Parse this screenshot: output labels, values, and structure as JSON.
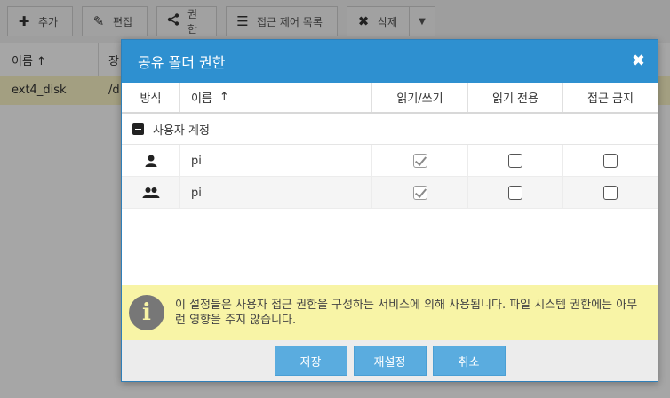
{
  "toolbar": {
    "buttons": [
      {
        "label": "추가",
        "icon": "plus-icon"
      },
      {
        "label": "편집",
        "icon": "pencil-icon"
      },
      {
        "label": "권한",
        "icon": "share-icon"
      },
      {
        "label": "접근 제어 목록",
        "icon": "list-icon"
      },
      {
        "label": "삭제",
        "icon": "x-icon"
      }
    ]
  },
  "background_grid": {
    "columns": [
      "이름",
      "장"
    ],
    "rows": [
      [
        "ext4_disk",
        "/d"
      ]
    ]
  },
  "dialog": {
    "title": "공유 폴더 권한",
    "columns": {
      "type": "방식",
      "name": "이름",
      "read_write": "읽기/쓰기",
      "read_only": "읽기 전용",
      "no_access": "접근 금지"
    },
    "group_label": "사용자 계정",
    "rows": [
      {
        "type_icon": "user-icon",
        "name": "pi",
        "read_write": true,
        "read_only": false,
        "no_access": false
      },
      {
        "type_icon": "group-icon",
        "name": "pi",
        "read_write": true,
        "read_only": false,
        "no_access": false
      }
    ],
    "info_text": "이 설정들은 사용자 접근 권한을 구성하는 서비스에 의해 사용됩니다. 파일 시스템 권한에는 아무런 영향을 주지 않습니다.",
    "buttons": {
      "save": "저장",
      "reset": "재설정",
      "cancel": "취소"
    }
  }
}
